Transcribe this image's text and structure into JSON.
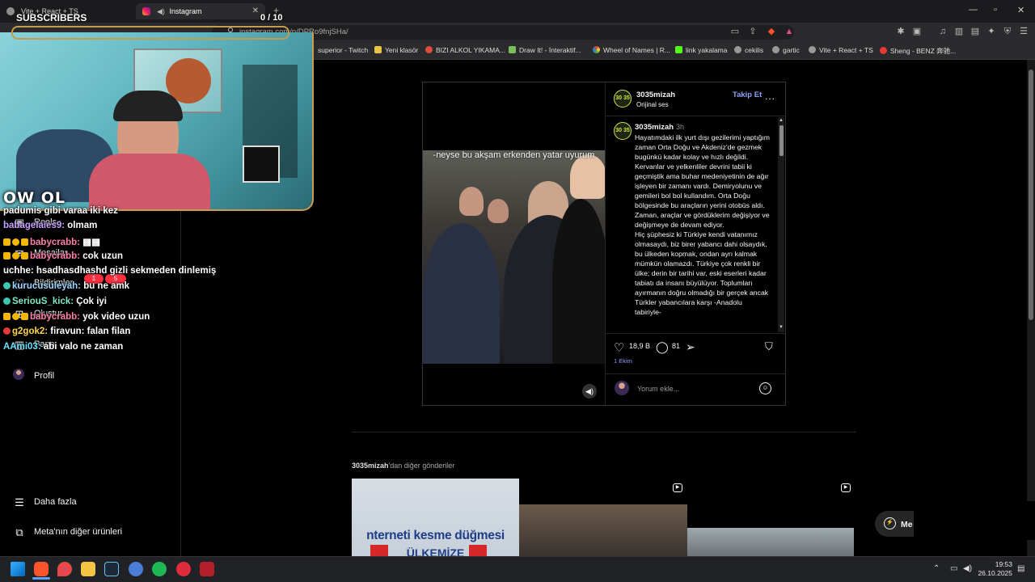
{
  "browser": {
    "tabs": [
      {
        "title": "Vite + React + TS"
      },
      {
        "title": "Instagram"
      }
    ],
    "url": "instagram.com/p/DPRo9fnjSHa/",
    "bookmarks": [
      "superior - Twitch",
      "Yeni klasör",
      "BIZI ALKOL YIKAMA...",
      "Draw It! - İnteraktif...",
      "Wheel of Names | R...",
      "link yakalama",
      "cekilis",
      "gartic",
      "Vite + React + TS",
      "Sheng - BENZ 奔驰..."
    ]
  },
  "overlay": {
    "subscribers_label": "SUBSCRIBERS",
    "subscribers_count": "0 / 10",
    "logo": "OW OL"
  },
  "sidebar": {
    "items": [
      {
        "label": "Reels",
        "icon": "reels-icon"
      },
      {
        "label": "Mesajlar",
        "icon": "messages-icon"
      },
      {
        "label": "Bildirimler",
        "icon": "heart-icon"
      },
      {
        "label": "Oluştur",
        "icon": "plus-icon"
      },
      {
        "label": "Pano",
        "icon": "dashboard-icon"
      },
      {
        "label": "Profil",
        "icon": "avatar"
      }
    ],
    "more": "Daha fazla",
    "meta": "Meta'nın diğer ürünleri",
    "badge_messages": "1",
    "badge_notifications": "5"
  },
  "chat": [
    {
      "user": "padumis gibi varaa iki kez",
      "msg": "",
      "color": "#ffffff"
    },
    {
      "user": "babagelaies9:",
      "msg": "olmam",
      "color": "#c9a2ff"
    },
    {
      "user": "babycrabb:",
      "msg": "▩▩",
      "color": "#ff7fa8"
    },
    {
      "user": "babycrabb:",
      "msg": "cok uzun",
      "color": "#ff7fa8"
    },
    {
      "user": "uchhe:",
      "msg": "hsadhasdhashd gizli sekmeden dinlemiş",
      "color": "#ffffff"
    },
    {
      "user": "kurucusuleyah:",
      "msg": "bu ne amk",
      "color": "#9ad7ff"
    },
    {
      "user": "SeriouS_kick:",
      "msg": "Çok iyi",
      "color": "#7ee8c3"
    },
    {
      "user": "babycrabb:",
      "msg": "yok video uzun",
      "color": "#ff7fa8"
    },
    {
      "user": "g2gok2:",
      "msg": "firavun: falan filan",
      "color": "#ffd54a"
    },
    {
      "user": "AAmi03:",
      "msg": "abi valo ne zaman",
      "color": "#6ee0ff"
    }
  ],
  "post": {
    "username": "3035mizah",
    "audio": "Orijinal ses",
    "follow": "Takip Et",
    "more": "...",
    "avatar_text": "30 35",
    "video_caption": "-neyse bu akşam erkenden yatar uyurum",
    "caption_time": "3h",
    "caption": "Hayatımdaki ilk yurt dışı gezilerimi yaptığım zaman Orta Doğu ve Akdeniz'de gezmek bugünkü kadar kolay ve hızlı değildi. Kervanlar ve yelkenliler devrini tabii ki geçmiştik ama buhar medeniyetinin de ağır işleyen bir zamanı vardı. Demiryolunu ve gemileri bol bol kullandım. Orta Doğu bölgesinde bu araçların yerini otobüs aldı. Zaman, araçlar ve gördüklerim değişiyor ve değişmeye de devam ediyor.\nHiç şüphesiz ki Türkiye kendi vatanımız olmasaydı, biz birer yabancı dahi olsaydık, bu ülkeden kopmak, ondan ayrı kalmak mümkün olamazdı. Türkiye çok renkli bir ülke; derin bir tarihi var, eski eserleri kadar tabiatı da insanı büyülüyor. Toplumları ayırmanın doğru olmadığı bir gerçek ancak Türkler yabancılara karşı -Anadolu tabiriyle-",
    "likes": "18,9 B",
    "comments": "81",
    "date": "1 Ekim",
    "comment_placeholder": "Yorum ekle..."
  },
  "more_posts": {
    "username": "3035mizah",
    "suffix": "'dan diğer gönderiler",
    "thumb1_line1": "nterneti kesme düğmesi",
    "thumb1_line2": "ÜLKEMİZE"
  },
  "messages_pill": "Me",
  "taskbar": {
    "time": "19:53",
    "date": "26.10.2025"
  }
}
